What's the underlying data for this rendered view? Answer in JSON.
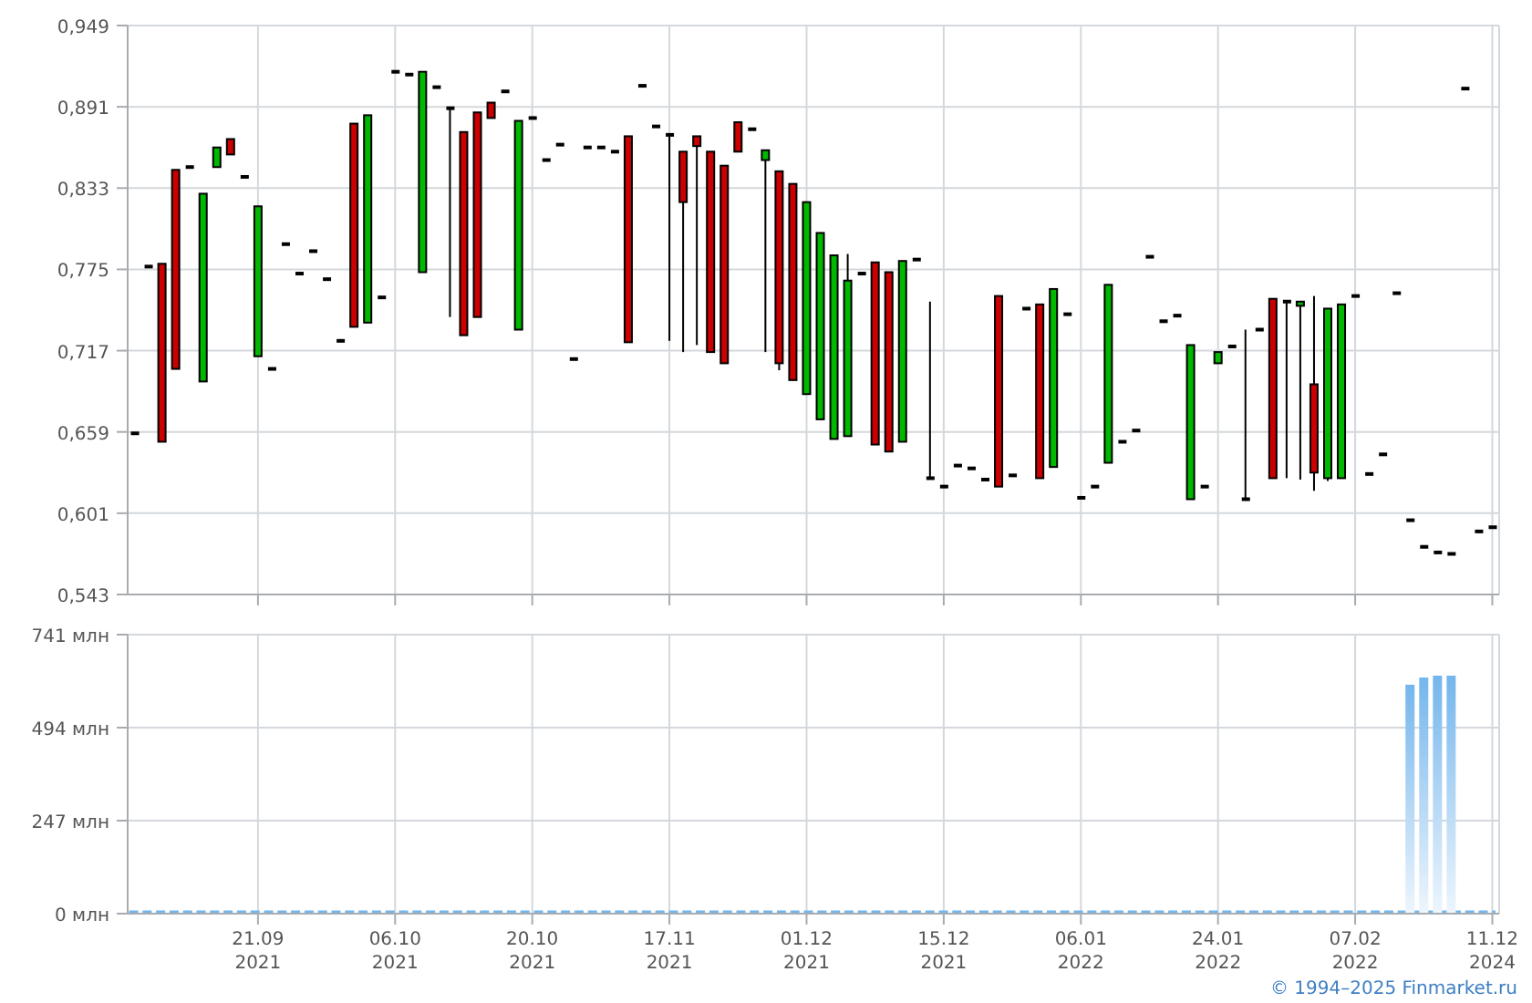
{
  "price_chart": {
    "chart_data": {
      "type": "candlestick",
      "grid": true,
      "ylim": [
        0.543,
        0.949
      ],
      "yticks": [
        {
          "value": 0.543,
          "label": "0,543"
        },
        {
          "value": 0.601,
          "label": "0,601"
        },
        {
          "value": 0.659,
          "label": "0,659"
        },
        {
          "value": 0.717,
          "label": "0,717"
        },
        {
          "value": 0.775,
          "label": "0,775"
        },
        {
          "value": 0.833,
          "label": "0,833"
        },
        {
          "value": 0.891,
          "label": "0,891"
        },
        {
          "value": 0.949,
          "label": "0,949"
        }
      ],
      "categories": [
        null,
        null,
        null,
        null,
        null,
        null,
        null,
        null,
        null,
        null,
        null,
        null,
        null,
        null,
        null,
        null,
        null,
        null,
        null,
        null,
        null,
        null,
        null,
        null,
        null,
        null,
        null,
        null,
        null,
        null,
        null,
        null,
        null,
        null,
        null,
        null,
        null,
        null,
        null,
        null,
        null,
        null,
        null,
        null,
        null,
        null,
        null,
        null,
        null,
        null,
        null,
        null,
        null,
        null,
        null,
        null,
        null,
        null,
        null,
        null,
        null,
        null,
        null,
        null,
        null,
        null,
        null,
        null,
        null,
        null,
        null,
        null,
        null,
        null,
        null,
        null,
        null,
        null,
        null,
        null,
        null,
        null,
        null,
        null,
        null,
        null,
        null,
        null,
        null,
        null,
        null,
        null,
        null,
        null,
        null,
        null,
        null,
        null,
        null,
        null
      ],
      "ohlc": [
        [
          0.658,
          0.658,
          0.658,
          0.658
        ],
        [
          0.777,
          0.777,
          0.777,
          0.777
        ],
        [
          0.779,
          0.779,
          0.652,
          0.652
        ],
        [
          0.846,
          0.846,
          0.704,
          0.704
        ],
        [
          0.848,
          0.848,
          0.848,
          0.848
        ],
        [
          0.695,
          0.829,
          0.695,
          0.829
        ],
        [
          0.848,
          0.862,
          0.848,
          0.862
        ],
        [
          0.868,
          0.868,
          0.857,
          0.857
        ],
        [
          0.841,
          0.841,
          0.841,
          0.841
        ],
        [
          0.713,
          0.82,
          0.713,
          0.82
        ],
        [
          0.704,
          0.704,
          0.704,
          0.704
        ],
        [
          0.793,
          0.793,
          0.793,
          0.793
        ],
        [
          0.772,
          0.772,
          0.772,
          0.772
        ],
        [
          0.788,
          0.788,
          0.788,
          0.788
        ],
        [
          0.768,
          0.768,
          0.768,
          0.768
        ],
        [
          0.724,
          0.724,
          0.724,
          0.724
        ],
        [
          0.879,
          0.879,
          0.734,
          0.734
        ],
        [
          0.737,
          0.885,
          0.737,
          0.885
        ],
        [
          0.755,
          0.755,
          0.755,
          0.755
        ],
        [
          0.916,
          0.916,
          0.916,
          0.916
        ],
        [
          0.914,
          0.914,
          0.914,
          0.914
        ],
        [
          0.773,
          0.916,
          0.773,
          0.916
        ],
        [
          0.905,
          0.905,
          0.905,
          0.905
        ],
        [
          0.89,
          0.89,
          0.741,
          0.89
        ],
        [
          0.873,
          0.873,
          0.728,
          0.728
        ],
        [
          0.887,
          0.887,
          0.741,
          0.741
        ],
        [
          0.894,
          0.894,
          0.883,
          0.883
        ],
        [
          0.902,
          0.902,
          0.902,
          0.902
        ],
        [
          0.732,
          0.881,
          0.732,
          0.881
        ],
        [
          0.883,
          0.883,
          0.883,
          0.883
        ],
        [
          0.853,
          0.853,
          0.853,
          0.853
        ],
        [
          0.864,
          0.864,
          0.864,
          0.864
        ],
        [
          0.711,
          0.711,
          0.711,
          0.711
        ],
        [
          0.862,
          0.862,
          0.862,
          0.862
        ],
        [
          0.862,
          0.862,
          0.862,
          0.862
        ],
        [
          0.859,
          0.859,
          0.859,
          0.859
        ],
        [
          0.87,
          0.87,
          0.723,
          0.723
        ],
        [
          0.906,
          0.906,
          0.906,
          0.906
        ],
        [
          0.877,
          0.877,
          0.877,
          0.877
        ],
        [
          0.871,
          0.871,
          0.724,
          0.871
        ],
        [
          0.859,
          0.859,
          0.716,
          0.823
        ],
        [
          0.87,
          0.87,
          0.721,
          0.863
        ],
        [
          0.859,
          0.859,
          0.716,
          0.716
        ],
        [
          0.849,
          0.849,
          0.708,
          0.708
        ],
        [
          0.88,
          0.88,
          0.859,
          0.859
        ],
        [
          0.875,
          0.875,
          0.875,
          0.875
        ],
        [
          0.853,
          0.86,
          0.716,
          0.86
        ],
        [
          0.845,
          0.845,
          0.703,
          0.708
        ],
        [
          0.836,
          0.836,
          0.696,
          0.696
        ],
        [
          0.686,
          0.823,
          0.686,
          0.823
        ],
        [
          0.668,
          0.801,
          0.668,
          0.801
        ],
        [
          0.654,
          0.785,
          0.654,
          0.785
        ],
        [
          0.656,
          0.786,
          0.656,
          0.767
        ],
        [
          0.772,
          0.772,
          0.772,
          0.772
        ],
        [
          0.78,
          0.78,
          0.65,
          0.65
        ],
        [
          0.773,
          0.773,
          0.645,
          0.645
        ],
        [
          0.652,
          0.781,
          0.652,
          0.781
        ],
        [
          0.782,
          0.782,
          0.782,
          0.782
        ],
        [
          0.626,
          0.752,
          0.626,
          0.626
        ],
        [
          0.62,
          0.62,
          0.62,
          0.62
        ],
        [
          0.635,
          0.635,
          0.635,
          0.635
        ],
        [
          0.633,
          0.633,
          0.633,
          0.633
        ],
        [
          0.625,
          0.625,
          0.625,
          0.625
        ],
        [
          0.756,
          0.756,
          0.62,
          0.62
        ],
        [
          0.628,
          0.628,
          0.628,
          0.628
        ],
        [
          0.747,
          0.747,
          0.747,
          0.747
        ],
        [
          0.75,
          0.75,
          0.626,
          0.626
        ],
        [
          0.634,
          0.761,
          0.634,
          0.761
        ],
        [
          0.743,
          0.743,
          0.743,
          0.743
        ],
        [
          0.612,
          0.612,
          0.612,
          0.612
        ],
        [
          0.62,
          0.62,
          0.62,
          0.62
        ],
        [
          0.637,
          0.764,
          0.637,
          0.764
        ],
        [
          0.652,
          0.652,
          0.652,
          0.652
        ],
        [
          0.66,
          0.66,
          0.66,
          0.66
        ],
        [
          0.784,
          0.784,
          0.784,
          0.784
        ],
        [
          0.738,
          0.738,
          0.738,
          0.738
        ],
        [
          0.742,
          0.742,
          0.742,
          0.742
        ],
        [
          0.611,
          0.721,
          0.611,
          0.721
        ],
        [
          0.62,
          0.62,
          0.62,
          0.62
        ],
        [
          0.708,
          0.716,
          0.708,
          0.716
        ],
        [
          0.72,
          0.72,
          0.72,
          0.72
        ],
        [
          0.611,
          0.732,
          0.611,
          0.611
        ],
        [
          0.732,
          0.732,
          0.732,
          0.732
        ],
        [
          0.754,
          0.754,
          0.626,
          0.626
        ],
        [
          0.752,
          0.752,
          0.626,
          0.752
        ],
        [
          0.749,
          0.752,
          0.625,
          0.752
        ],
        [
          0.693,
          0.756,
          0.617,
          0.63
        ],
        [
          0.626,
          0.747,
          0.624,
          0.747
        ],
        [
          0.626,
          0.75,
          0.626,
          0.75
        ],
        [
          0.756,
          0.756,
          0.756,
          0.756
        ],
        [
          0.629,
          0.629,
          0.629,
          0.629
        ],
        [
          0.643,
          0.643,
          0.643,
          0.643
        ],
        [
          0.758,
          0.758,
          0.758,
          0.758
        ],
        [
          0.596,
          0.596,
          0.596,
          0.596
        ],
        [
          0.577,
          0.577,
          0.577,
          0.577
        ],
        [
          0.573,
          0.573,
          0.573,
          0.573
        ],
        [
          0.572,
          0.572,
          0.572,
          0.572
        ],
        [
          0.904,
          0.904,
          0.904,
          0.904
        ],
        [
          0.588,
          0.588,
          0.588,
          0.588
        ],
        [
          0.591,
          0.591,
          0.591,
          0.591
        ]
      ]
    }
  },
  "volume_chart": {
    "chart_data": {
      "type": "bar",
      "grid": true,
      "ylim": [
        0,
        741
      ],
      "yticks": [
        {
          "value": 0,
          "label": "0 млн"
        },
        {
          "value": 247,
          "label": "247 млн"
        },
        {
          "value": 494,
          "label": "494 млн"
        },
        {
          "value": 741,
          "label": "741 млн"
        }
      ],
      "categories": [
        null,
        null,
        null,
        null,
        null,
        null,
        null,
        null,
        null,
        "21.09 2021",
        null,
        null,
        null,
        null,
        null,
        null,
        null,
        null,
        null,
        "06.10 2021",
        null,
        null,
        null,
        null,
        null,
        null,
        null,
        null,
        null,
        "20.10 2021",
        null,
        null,
        null,
        null,
        null,
        null,
        null,
        null,
        null,
        "17.11 2021",
        null,
        null,
        null,
        null,
        null,
        null,
        null,
        null,
        null,
        "01.12 2021",
        null,
        null,
        null,
        null,
        null,
        null,
        null,
        null,
        null,
        "15.12 2021",
        null,
        null,
        null,
        null,
        null,
        null,
        null,
        null,
        null,
        "06.01 2022",
        null,
        null,
        null,
        null,
        null,
        null,
        null,
        null,
        null,
        "24.01 2022",
        null,
        null,
        null,
        null,
        null,
        null,
        null,
        null,
        null,
        "07.02 2022",
        null,
        null,
        null,
        null,
        null,
        null,
        null,
        null,
        null,
        "11.12 2024"
      ],
      "series": [
        {
          "color": "#74b6ec",
          "values": [
            0,
            0,
            0,
            0,
            0,
            0,
            0,
            0,
            0,
            0,
            0,
            0,
            0,
            0,
            0,
            0,
            0,
            0,
            0,
            0,
            0,
            0,
            0,
            0,
            0,
            0,
            0,
            0,
            0,
            0,
            0,
            0,
            0,
            0,
            0,
            0,
            0,
            0,
            0,
            0,
            0,
            0,
            0,
            0,
            0,
            0,
            0,
            0,
            0,
            0,
            0,
            0,
            0,
            0,
            0,
            0,
            0,
            0,
            0,
            0,
            0,
            0,
            0,
            0,
            0,
            0,
            0,
            0,
            0,
            0,
            0,
            0,
            0,
            0,
            0,
            0,
            0,
            0,
            0,
            0,
            0,
            0,
            0,
            0,
            0,
            0,
            0,
            0,
            0,
            0,
            0,
            0,
            0,
            608,
            627,
            632,
            632,
            0,
            0,
            0
          ]
        }
      ]
    }
  },
  "footer": {
    "copyright": "© 1994–2025 Finmarket.ru"
  }
}
